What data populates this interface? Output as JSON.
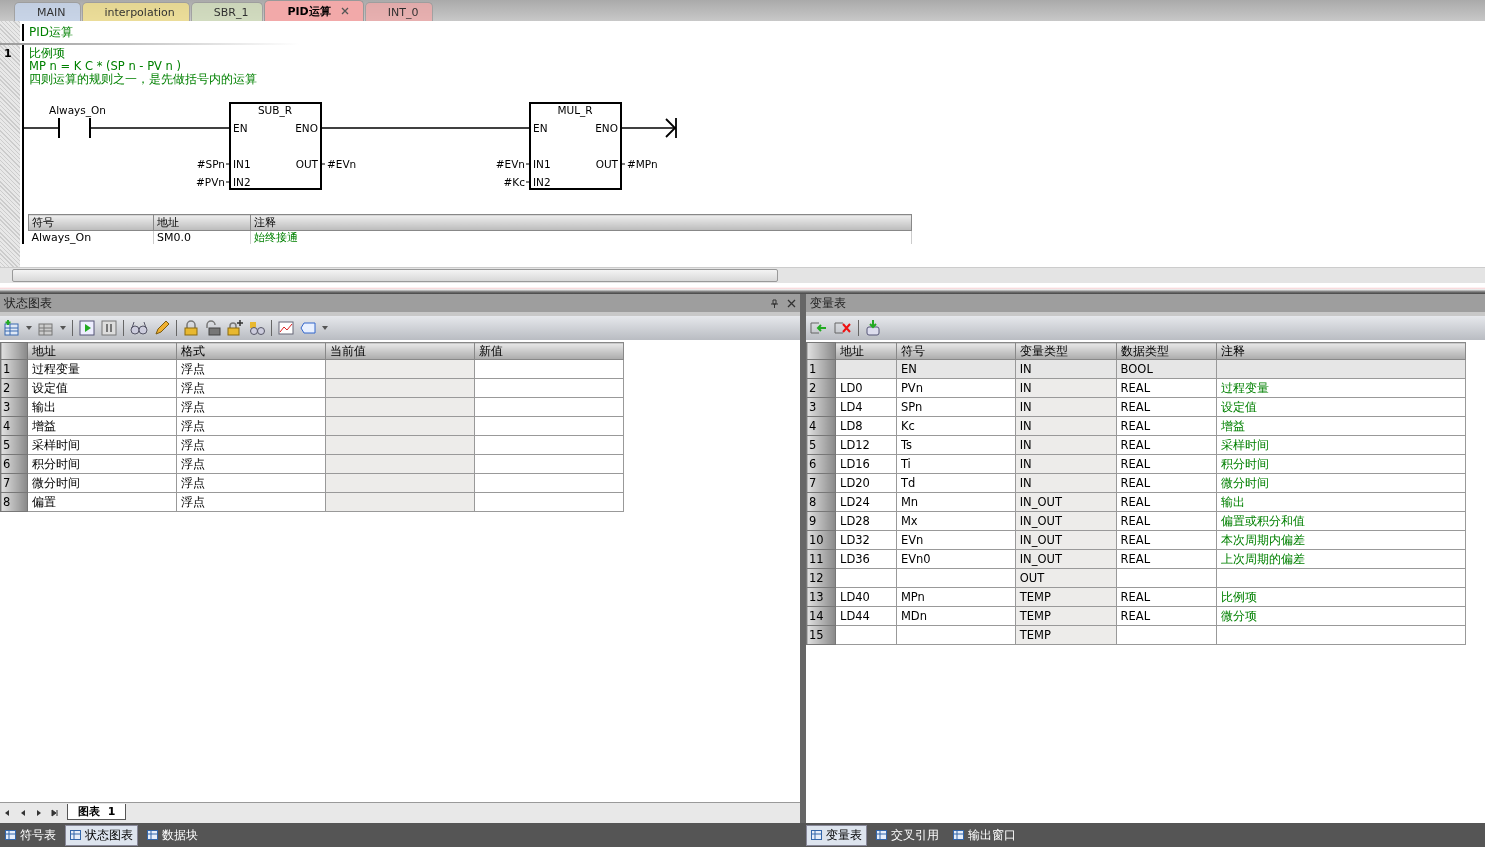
{
  "tabs": [
    {
      "label": "MAIN",
      "color": "#c9d9f2",
      "selected": false,
      "closable": false
    },
    {
      "label": "interpolation",
      "color": "#f7e48a",
      "selected": false,
      "closable": false
    },
    {
      "label": "SBR_1",
      "color": "#d5e2bd",
      "selected": false,
      "closable": false
    },
    {
      "label": "PID运算",
      "color": "#f2a9a9",
      "selected": true,
      "closable": true
    },
    {
      "label": "INT_0",
      "color": "#f2a9a9",
      "selected": false,
      "closable": false
    }
  ],
  "editor": {
    "title": "PID运算",
    "network": {
      "number": "1",
      "comment": [
        "比例项",
        "MP n = K C * (SP n - PV n )",
        "四则运算的规则之一，是先做括号内的运算"
      ],
      "ladder": {
        "contact": "Always_On",
        "blocks": [
          {
            "name": "SUB_R",
            "en": "EN",
            "eno": "ENO",
            "in1": "IN1",
            "in2": "IN2",
            "out": "OUT",
            "input1": "#SPn",
            "input2": "#PVn",
            "output": "#EVn"
          },
          {
            "name": "MUL_R",
            "en": "EN",
            "eno": "ENO",
            "in1": "IN1",
            "in2": "IN2",
            "out": "OUT",
            "input1": "#EVn",
            "input2": "#Kc",
            "output": "#MPn"
          }
        ]
      },
      "symbol_table": {
        "columns": [
          "符号",
          "地址",
          "注释"
        ],
        "rows": [
          [
            "Always_On",
            "SM0.0",
            "始终接通"
          ]
        ]
      }
    }
  },
  "status_chart": {
    "title": "状态图表",
    "columns": [
      "地址",
      "格式",
      "当前值",
      "新值"
    ],
    "rows": [
      {
        "number": "1",
        "address": "过程变量",
        "format": "浮点",
        "current": "",
        "new": ""
      },
      {
        "number": "2",
        "address": "设定值",
        "format": "浮点",
        "current": "",
        "new": ""
      },
      {
        "number": "3",
        "address": "输出",
        "format": "浮点",
        "current": "",
        "new": ""
      },
      {
        "number": "4",
        "address": "增益",
        "format": "浮点",
        "current": "",
        "new": ""
      },
      {
        "number": "5",
        "address": "采样时间",
        "format": "浮点",
        "current": "",
        "new": ""
      },
      {
        "number": "6",
        "address": "积分时间",
        "format": "浮点",
        "current": "",
        "new": ""
      },
      {
        "number": "7",
        "address": "微分时间",
        "format": "浮点",
        "current": "",
        "new": ""
      },
      {
        "number": "8",
        "address": "偏置",
        "format": "浮点",
        "current": "",
        "new": ""
      }
    ],
    "sheet_tab": "图表  1"
  },
  "variable_table": {
    "title": "变量表",
    "columns": [
      "地址",
      "符号",
      "变量类型",
      "数据类型",
      "注释"
    ],
    "rows": [
      {
        "number": "1",
        "address": "",
        "symbol": "EN",
        "var_type": "IN",
        "data_type": "BOOL",
        "comment": "",
        "disabled": true
      },
      {
        "number": "2",
        "address": "LD0",
        "symbol": "PVn",
        "var_type": "IN",
        "data_type": "REAL",
        "comment": "过程变量",
        "disabled": false
      },
      {
        "number": "3",
        "address": "LD4",
        "symbol": "SPn",
        "var_type": "IN",
        "data_type": "REAL",
        "comment": "设定值",
        "disabled": false
      },
      {
        "number": "4",
        "address": "LD8",
        "symbol": "Kc",
        "var_type": "IN",
        "data_type": "REAL",
        "comment": "增益",
        "disabled": false
      },
      {
        "number": "5",
        "address": "LD12",
        "symbol": "Ts",
        "var_type": "IN",
        "data_type": "REAL",
        "comment": "采样时间",
        "disabled": false
      },
      {
        "number": "6",
        "address": "LD16",
        "symbol": "Ti",
        "var_type": "IN",
        "data_type": "REAL",
        "comment": "积分时间",
        "disabled": false
      },
      {
        "number": "7",
        "address": "LD20",
        "symbol": "Td",
        "var_type": "IN",
        "data_type": "REAL",
        "comment": "微分时间",
        "disabled": false
      },
      {
        "number": "8",
        "address": "LD24",
        "symbol": "Mn",
        "var_type": "IN_OUT",
        "data_type": "REAL",
        "comment": "输出",
        "disabled": false
      },
      {
        "number": "9",
        "address": "LD28",
        "symbol": "Mx",
        "var_type": "IN_OUT",
        "data_type": "REAL",
        "comment": "偏置或积分和值",
        "disabled": false
      },
      {
        "number": "10",
        "address": "LD32",
        "symbol": "EVn",
        "var_type": "IN_OUT",
        "data_type": "REAL",
        "comment": "本次周期内偏差",
        "disabled": false
      },
      {
        "number": "11",
        "address": "LD36",
        "symbol": "EVn0",
        "var_type": "IN_OUT",
        "data_type": "REAL",
        "comment": "上次周期的偏差",
        "disabled": false
      },
      {
        "number": "12",
        "address": "",
        "symbol": "",
        "var_type": "OUT",
        "data_type": "",
        "comment": "",
        "disabled": false
      },
      {
        "number": "13",
        "address": "LD40",
        "symbol": "MPn",
        "var_type": "TEMP",
        "data_type": "REAL",
        "comment": "比例项",
        "disabled": false
      },
      {
        "number": "14",
        "address": "LD44",
        "symbol": "MDn",
        "var_type": "TEMP",
        "data_type": "REAL",
        "comment": "微分项",
        "disabled": false
      },
      {
        "number": "15",
        "address": "",
        "symbol": "",
        "var_type": "TEMP",
        "data_type": "",
        "comment": "",
        "disabled": false
      }
    ]
  },
  "bottom_tabs_left": [
    {
      "label": "符号表",
      "selected": false
    },
    {
      "label": "状态图表",
      "selected": true
    },
    {
      "label": "数据块",
      "selected": false
    }
  ],
  "bottom_tabs_right": [
    {
      "label": "变量表",
      "selected": true
    },
    {
      "label": "交叉引用",
      "selected": false
    },
    {
      "label": "输出窗口",
      "selected": false
    }
  ]
}
